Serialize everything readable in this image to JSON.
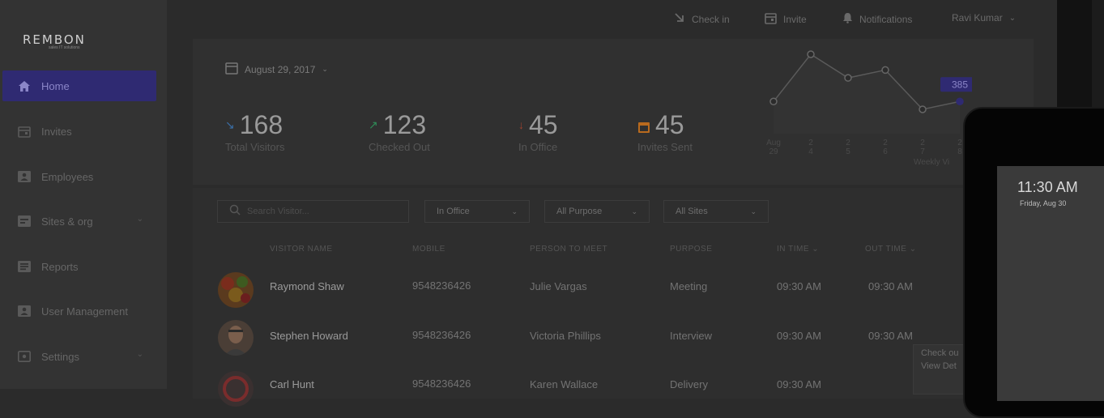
{
  "brand": {
    "name": "REMBON",
    "tagline": "sales IT solutions"
  },
  "sidebar": {
    "items": [
      {
        "label": "Home",
        "icon": "home-icon"
      },
      {
        "label": "Invites",
        "icon": "calendar-icon"
      },
      {
        "label": "Employees",
        "icon": "id-card-icon"
      },
      {
        "label": "Sites & org",
        "icon": "sites-icon",
        "expandable": true
      },
      {
        "label": "Reports",
        "icon": "reports-icon"
      },
      {
        "label": "User Management",
        "icon": "user-management-icon"
      },
      {
        "label": "Settings",
        "icon": "settings-icon",
        "expandable": true
      }
    ]
  },
  "topbar": {
    "checkin": "Check in",
    "invite": "Invite",
    "notifications": "Notifications",
    "user": "Ravi Kumar"
  },
  "summary": {
    "date": "August 29, 2017",
    "stats": [
      {
        "value": "168",
        "label": "Total Visitors",
        "color": "#3a6ea5"
      },
      {
        "value": "123",
        "label": "Checked Out",
        "color": "#2e8b57"
      },
      {
        "value": "45",
        "label": "In Office",
        "color": "#a0422e"
      },
      {
        "value": "45",
        "label": "Invites Sent",
        "color": "#b86a1e"
      }
    ]
  },
  "chart_data": {
    "type": "line",
    "categories": [
      "Aug 29",
      "2 4",
      "2 5",
      "2 6",
      "2 7",
      "2 8"
    ],
    "values": [
      2,
      8,
      5,
      6,
      1,
      2
    ],
    "highlight": {
      "label": "385",
      "index": 5
    },
    "xlabel": "Weekly Vi"
  },
  "filters": {
    "search_placeholder": "Search Visitor...",
    "status": "In Office",
    "purpose": "All Purpose",
    "sites": "All Sites"
  },
  "table": {
    "headers": [
      "VISITOR NAME",
      "MOBILE",
      "PERSON TO MEET",
      "PURPOSE",
      "IN TIME",
      "OUT TIME"
    ],
    "rows": [
      {
        "name": "Raymond Shaw",
        "mobile": "9548236426",
        "meet": "Julie Vargas",
        "purpose": "Meeting",
        "in": "09:30 AM",
        "out": "09:30 AM"
      },
      {
        "name": "Stephen Howard",
        "mobile": "9548236426",
        "meet": "Victoria Phillips",
        "purpose": "Interview",
        "in": "09:30 AM",
        "out": "09:30 AM"
      },
      {
        "name": "Carl Hunt",
        "mobile": "9548236426",
        "meet": "Karen Wallace",
        "purpose": "Delivery",
        "in": "09:30 AM",
        "out": ""
      }
    ]
  },
  "context_menu": {
    "item1": "Check ou",
    "item2": "View Det"
  },
  "phone": {
    "time": "11:30 AM",
    "date": "Friday, Aug 30"
  }
}
